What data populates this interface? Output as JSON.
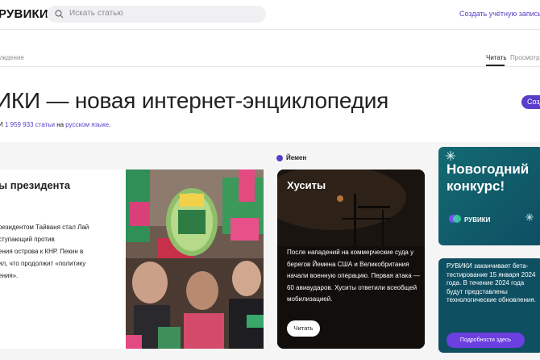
{
  "header": {
    "logo": "РУВИКИ",
    "search_placeholder": "Искать статью",
    "create_account": "Создать учётную запись"
  },
  "page": {
    "breadcrumb": "уждение",
    "tabs": {
      "read": "Читать",
      "view": "Просмотр"
    },
    "title": "ИКИ — новая интернет-энциклопедия",
    "create_button": "Созд",
    "stats": {
      "prefix": "И",
      "count_link": "1 959 933 статьи",
      "middle": "на",
      "lang_link": "русском языке",
      "suffix": "."
    }
  },
  "cards": {
    "elections": {
      "heading": "ы президента",
      "text": "резидентом Тайваня стал Лай\nступающий против\nения острова к КНР. Пекин в\nил, что продолжит «политику\nения»."
    },
    "yemen": {
      "tag": "Йемен",
      "heading": "Хуситы",
      "text": "После нападений на коммерческие суда у берегов Йемена США и Великобритания начали военную операцию. Первая атака — 60 авиаударов. Хуситы ответили всеобщей мобилизацией.",
      "button": "Читать"
    },
    "contest": {
      "heading": "Новогодний конкурс!",
      "brand": "РУВИКИ"
    },
    "beta": {
      "text": "РУВИКИ заканчивает бета-тестирование 15 января 2024 года. В течение 2024 года будут представлены технологические обновления.",
      "button": "Подробности здесь"
    }
  },
  "colors": {
    "accent": "#5a3dc8",
    "teal": "#0f4f62"
  }
}
